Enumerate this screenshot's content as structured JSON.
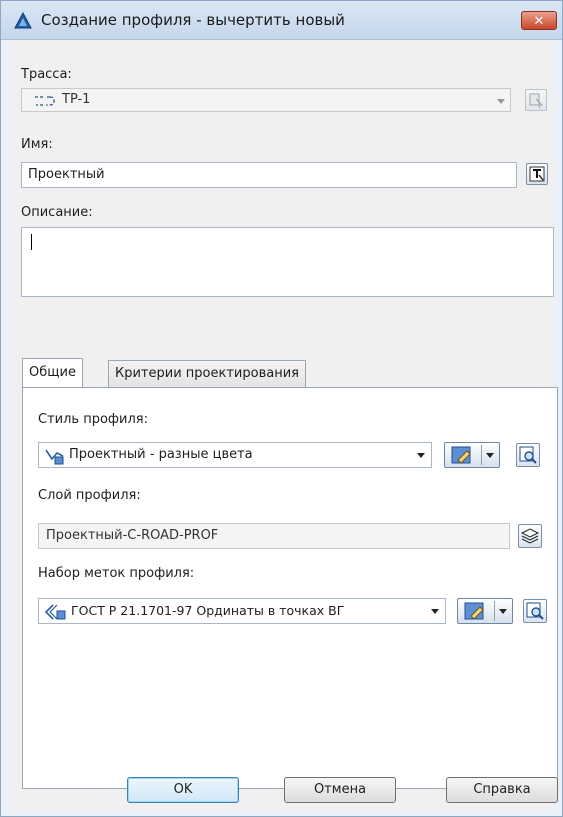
{
  "window": {
    "title": "Создание профиля - вычертить новый",
    "close_label": "✕"
  },
  "alignment": {
    "label": "Трасса:",
    "value": "TP-1",
    "icon": "alignment-icon"
  },
  "name": {
    "label": "Имя:",
    "value": "Проектный"
  },
  "description": {
    "label": "Описание:",
    "value": ""
  },
  "tabs": [
    {
      "label": "Общие",
      "active": true
    },
    {
      "label": "Критерии проектирования",
      "active": false
    }
  ],
  "general": {
    "profile_style_label": "Стиль профиля:",
    "profile_style_value": "Проектный - разные цвета",
    "profile_layer_label": "Слой профиля:",
    "profile_layer_value": "Проектный-C-ROAD-PROF",
    "label_set_label": "Набор меток профиля:",
    "label_set_value": "ГОСТ Р 21.1701-97 Ординаты в точках ВГ"
  },
  "buttons": {
    "ok": "OK",
    "cancel": "Отмена",
    "help": "Справка"
  },
  "colors": {
    "accent": "#3c7fb1",
    "close": "#c9472b"
  }
}
